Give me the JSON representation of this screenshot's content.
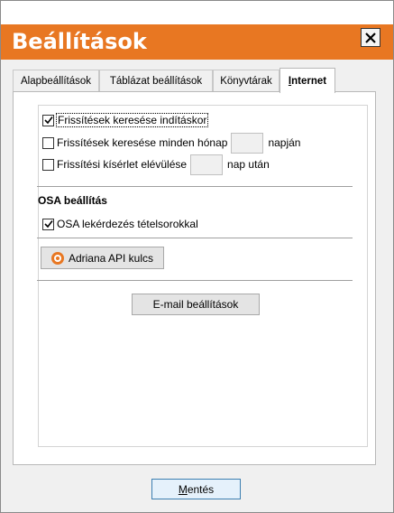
{
  "window": {
    "title": "Beállítások"
  },
  "tabs": [
    {
      "label": "Alapbeállítások"
    },
    {
      "label": "Táblázat beállítások"
    },
    {
      "label": "Könyvtárak"
    },
    {
      "label": "Internet",
      "active": true
    }
  ],
  "internet": {
    "check_updates_startup": {
      "label": "Frissítések keresése indításkor",
      "checked": true
    },
    "check_updates_monthly": {
      "label_before": "Frissítések keresése minden hónap",
      "value": "",
      "label_after": "napján",
      "checked": false
    },
    "update_expiry": {
      "label_before": "Frissítési kísérlet elévülése",
      "value": "",
      "label_after": "nap után",
      "checked": false
    }
  },
  "osa": {
    "section_title": "OSA beállítás",
    "item_queries": {
      "label": "OSA lekérdezés tételsorokkal",
      "checked": true
    }
  },
  "buttons": {
    "adriana_api": "Adriana API kulcs",
    "email_settings": "E-mail beállítások",
    "save_first": "M",
    "save_rest": "entés"
  },
  "icons": {
    "close": "close-icon",
    "checkmark": "checkmark-icon",
    "radio": "radio-icon"
  },
  "colors": {
    "accent": "#e87722",
    "title_text": "#ffffff"
  }
}
